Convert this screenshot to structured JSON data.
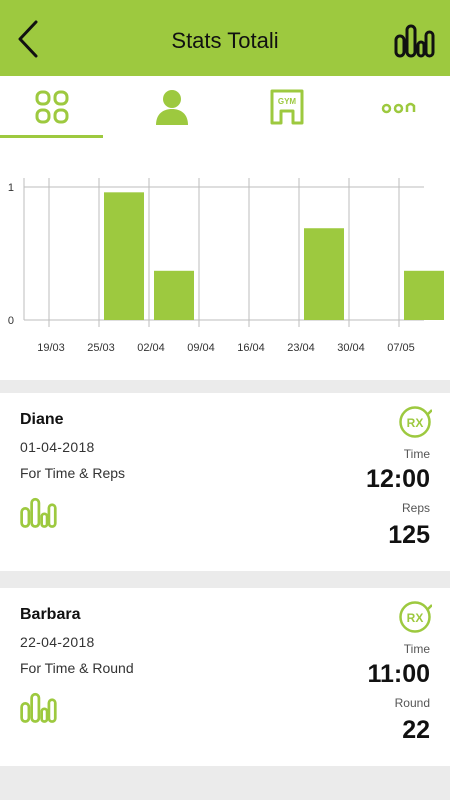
{
  "header": {
    "title": "Stats Totali",
    "back_icon": "chevron-left-icon",
    "logo_icon": "app-logo-icon"
  },
  "tabs": [
    {
      "id": "overview",
      "icon": "grid-icon",
      "active": true
    },
    {
      "id": "profile",
      "icon": "person-icon",
      "active": false
    },
    {
      "id": "gym",
      "icon": "gym-icon",
      "label": "GYM",
      "active": false
    },
    {
      "id": "more",
      "icon": "more-icon",
      "active": false
    }
  ],
  "chart_data": {
    "type": "bar",
    "categories": [
      "19/03",
      "25/03",
      "02/04",
      "09/04",
      "16/04",
      "23/04",
      "30/04",
      "07/05"
    ],
    "values": [
      0,
      0.96,
      0.37,
      0,
      0,
      0.69,
      0,
      0.37
    ],
    "ylim": [
      0,
      1
    ],
    "yticks": [
      "0",
      "1"
    ],
    "grid": true,
    "color": "#9dc93f"
  },
  "workouts": [
    {
      "name": "Diane",
      "date": "01-04-2018",
      "type": "For Time & Reps",
      "badge": "RX",
      "stat1_label": "Time",
      "stat1_value": "12:00",
      "stat2_label": "Reps",
      "stat2_value": "125"
    },
    {
      "name": "Barbara",
      "date": "22-04-2018",
      "type": "For Time & Round",
      "badge": "RX",
      "stat1_label": "Time",
      "stat1_value": "11:00",
      "stat2_label": "Round",
      "stat2_value": "22"
    }
  ],
  "colors": {
    "accent": "#9dc93f",
    "background": "#ebebeb"
  }
}
